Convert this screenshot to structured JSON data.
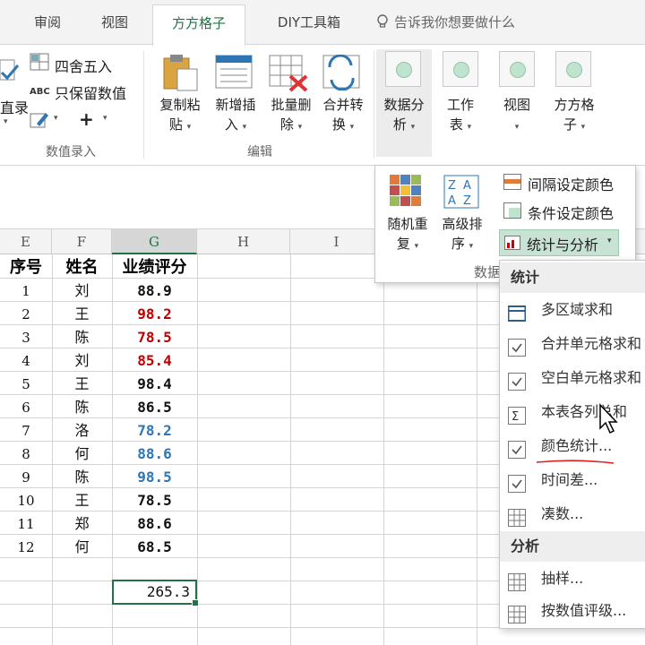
{
  "tabs": [
    {
      "label": "审阅",
      "active": false
    },
    {
      "label": "视图",
      "active": false
    },
    {
      "label": "方方格子",
      "active": true
    },
    {
      "label": "DIY工具箱",
      "active": false
    }
  ],
  "tell_me": "告诉我你想要做什么",
  "ribbon": {
    "value_entry": {
      "round": "四舍五入",
      "keep_values": "只保留数值",
      "plus": "+",
      "partial_left": "直录",
      "group_label": "数值录入"
    },
    "edit": {
      "copy_paste": [
        "复制粘",
        "贴"
      ],
      "new_insert": [
        "新增插",
        "入"
      ],
      "batch_delete": [
        "批量删",
        "除"
      ],
      "merge_convert": [
        "合并转",
        "换"
      ],
      "group_label": "编辑"
    },
    "data_analysis": [
      "数据分",
      "析"
    ],
    "worksheet": [
      "工作",
      "表"
    ],
    "view": [
      "视图"
    ],
    "fangfang": [
      "方方格",
      "子"
    ],
    "caret": "▾"
  },
  "subpanel": {
    "random_repeat": [
      "随机重",
      "复"
    ],
    "advanced_sort": [
      "高级排",
      "序"
    ],
    "interval_color": "间隔设定颜色",
    "condition_color": "条件设定颜色",
    "stats_analysis": "统计与分析",
    "group_label_partial": "数据"
  },
  "menu": {
    "section_stats": "统计",
    "items_stats": [
      "多区域求和",
      "合并单元格求和",
      "空白单元格求和",
      "本表各列总和",
      "颜色统计...",
      "时间差...",
      "凑数..."
    ],
    "section_analysis": "分析",
    "items_analysis": [
      "抽样...",
      "按数值评级..."
    ]
  },
  "sheet": {
    "columns": [
      "E",
      "F",
      "G",
      "H",
      "I"
    ],
    "headers": {
      "seq": "序号",
      "name": "姓名",
      "score": "业绩评分"
    },
    "rows": [
      {
        "seq": "1",
        "name": "刘",
        "score": "88.9",
        "color": "#111111"
      },
      {
        "seq": "2",
        "name": "王",
        "score": "98.2",
        "color": "#c00000"
      },
      {
        "seq": "3",
        "name": "陈",
        "score": "78.5",
        "color": "#c00000"
      },
      {
        "seq": "4",
        "name": "刘",
        "score": "85.4",
        "color": "#c00000"
      },
      {
        "seq": "5",
        "name": "王",
        "score": "98.4",
        "color": "#111111"
      },
      {
        "seq": "6",
        "name": "陈",
        "score": "86.5",
        "color": "#111111"
      },
      {
        "seq": "7",
        "name": "洛",
        "score": "78.2",
        "color": "#2e75b6"
      },
      {
        "seq": "8",
        "name": "何",
        "score": "88.6",
        "color": "#2e75b6"
      },
      {
        "seq": "9",
        "name": "陈",
        "score": "98.5",
        "color": "#2e75b6"
      },
      {
        "seq": "10",
        "name": "王",
        "score": "78.5",
        "color": "#111111"
      },
      {
        "seq": "11",
        "name": "郑",
        "score": "88.6",
        "color": "#111111"
      },
      {
        "seq": "12",
        "name": "何",
        "score": "68.5",
        "color": "#111111"
      }
    ],
    "sum_value": "265.3"
  },
  "colors": {
    "accent": "#217346",
    "red": "#c00000",
    "blue": "#2e75b6",
    "highlight": "#c8e3d3"
  }
}
